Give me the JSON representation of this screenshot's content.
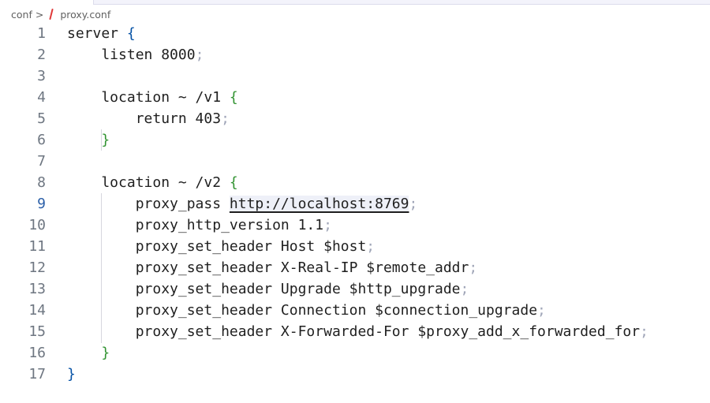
{
  "breadcrumb": {
    "folder": "conf",
    "separator": ">",
    "file": "proxy.conf"
  },
  "editor": {
    "current_line": 9,
    "lines": [
      {
        "num": "1",
        "parts": [
          {
            "t": "server "
          },
          {
            "t": "{",
            "c": "b1"
          }
        ]
      },
      {
        "num": "2",
        "parts": [
          {
            "t": "    listen 8000"
          },
          {
            "t": ";",
            "c": "semi"
          }
        ]
      },
      {
        "num": "3",
        "parts": []
      },
      {
        "num": "4",
        "parts": [
          {
            "t": "    location ~ /v1 "
          },
          {
            "t": "{",
            "c": "b2"
          }
        ]
      },
      {
        "num": "5",
        "parts": [
          {
            "t": "        return 403"
          },
          {
            "t": ";",
            "c": "semi"
          }
        ]
      },
      {
        "num": "6",
        "parts": [
          {
            "t": "    "
          },
          {
            "t": "}",
            "c": "b2"
          }
        ]
      },
      {
        "num": "7",
        "parts": []
      },
      {
        "num": "8",
        "parts": [
          {
            "t": "    location ~ /v2 "
          },
          {
            "t": "{",
            "c": "b2"
          }
        ]
      },
      {
        "num": "9",
        "parts": [
          {
            "t": "        proxy_pass "
          },
          {
            "t": "http://localhost:8769",
            "c": "link"
          },
          {
            "t": ";",
            "c": "semi"
          }
        ]
      },
      {
        "num": "10",
        "parts": [
          {
            "t": "        proxy_http_version 1.1"
          },
          {
            "t": ";",
            "c": "semi"
          }
        ]
      },
      {
        "num": "11",
        "parts": [
          {
            "t": "        proxy_set_header Host $host"
          },
          {
            "t": ";",
            "c": "semi"
          }
        ]
      },
      {
        "num": "12",
        "parts": [
          {
            "t": "        proxy_set_header X-Real-IP $remote_addr"
          },
          {
            "t": ";",
            "c": "semi"
          }
        ]
      },
      {
        "num": "13",
        "parts": [
          {
            "t": "        proxy_set_header Upgrade $http_upgrade"
          },
          {
            "t": ";",
            "c": "semi"
          }
        ]
      },
      {
        "num": "14",
        "parts": [
          {
            "t": "        proxy_set_header Connection $connection_upgrade"
          },
          {
            "t": ";",
            "c": "semi"
          }
        ]
      },
      {
        "num": "15",
        "parts": [
          {
            "t": "        proxy_set_header X-Forwarded-For $proxy_add_x_forwarded_for"
          },
          {
            "t": ";",
            "c": "semi"
          }
        ]
      },
      {
        "num": "16",
        "parts": [
          {
            "t": "    "
          },
          {
            "t": "}",
            "c": "b2"
          }
        ]
      },
      {
        "num": "17",
        "parts": [
          {
            "t": "}",
            "c": "b1"
          }
        ]
      }
    ]
  },
  "icons": {
    "file_icon": "nginx-file-icon"
  },
  "colors": {
    "bracket_level1": "#0451a5",
    "bracket_level2": "#319331",
    "line_number": "#6e7681",
    "current_line_number": "#2b5fa8"
  }
}
